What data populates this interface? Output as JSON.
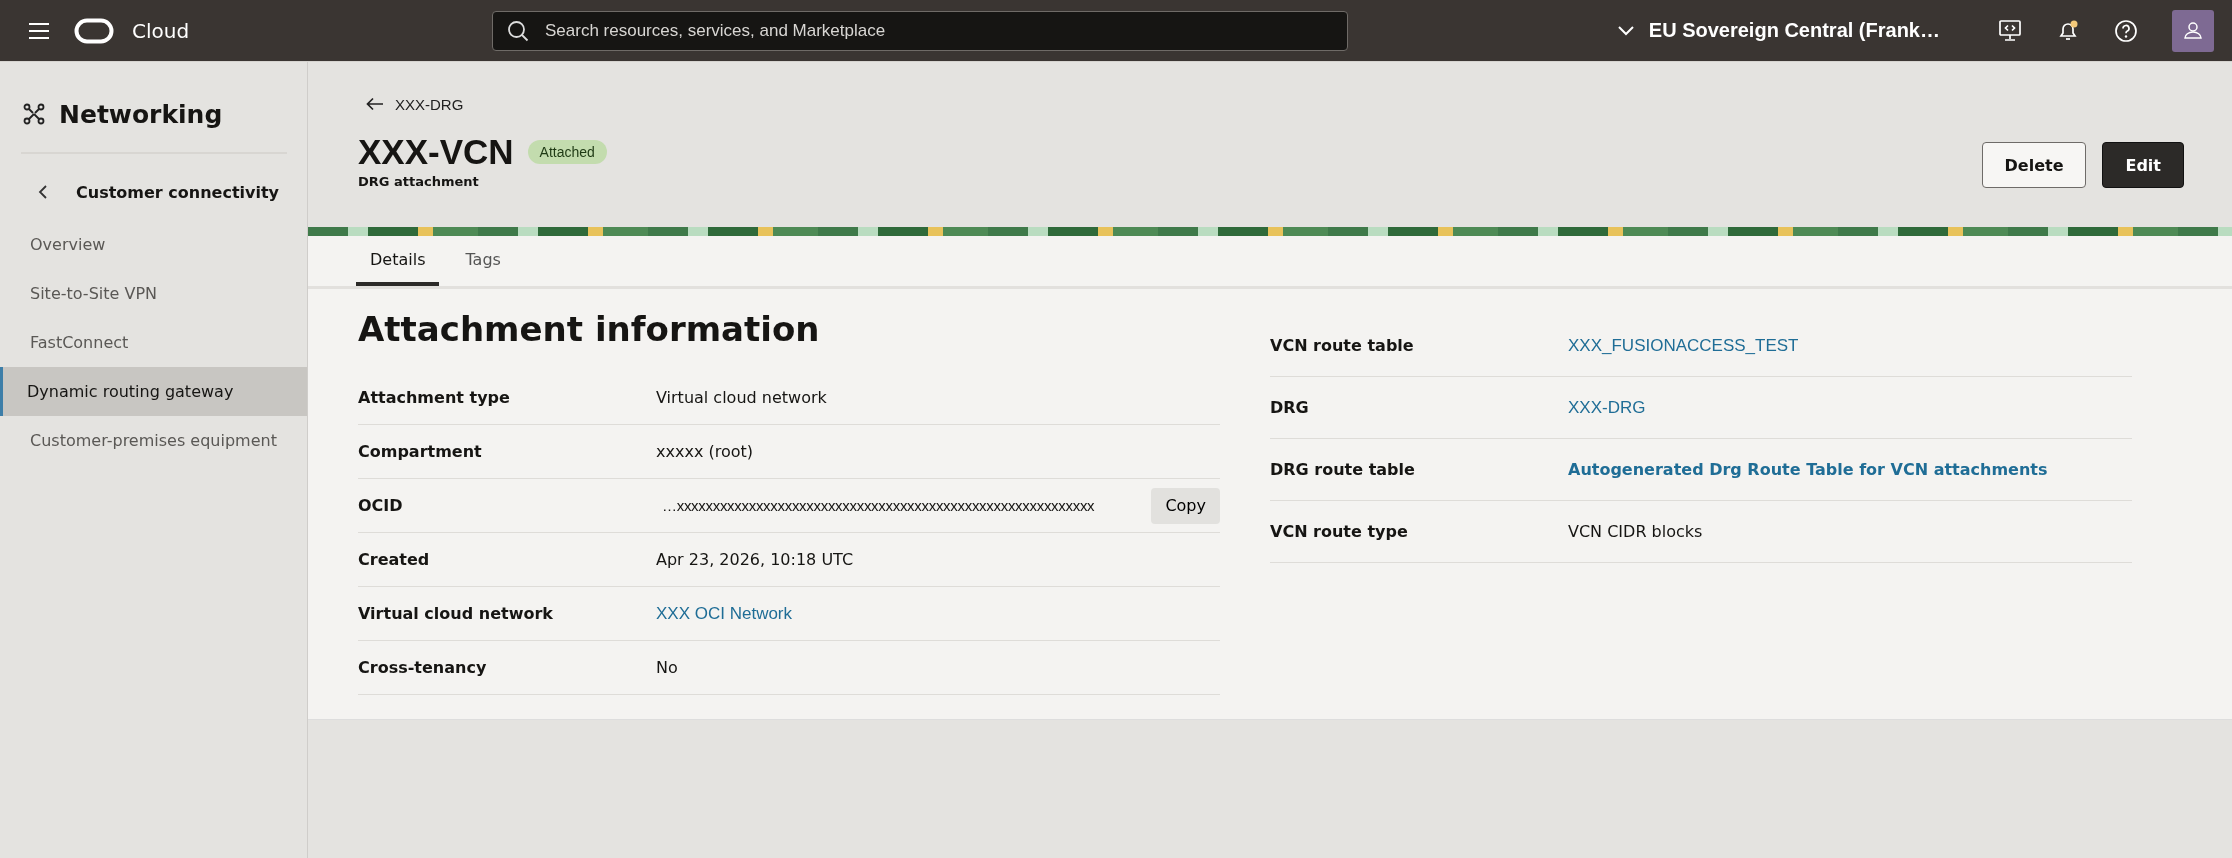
{
  "top_bar": {
    "brand": "Cloud",
    "search": {
      "placeholder": "Search resources, services, and Marketplace"
    },
    "region": "EU Sovereign Central (Frank…"
  },
  "sidebar": {
    "title": "Networking",
    "section": "Customer connectivity",
    "items": [
      {
        "label": "Overview",
        "selected": false
      },
      {
        "label": "Site-to-Site VPN",
        "selected": false
      },
      {
        "label": "FastConnect",
        "selected": false
      },
      {
        "label": "Dynamic routing gateway",
        "selected": true
      },
      {
        "label": "Customer-premises equipment",
        "selected": false
      }
    ]
  },
  "header": {
    "breadcrumb": "XXX-DRG",
    "title": "XXX-VCN",
    "status": "Attached",
    "subtitle": "DRG attachment",
    "buttons": [
      {
        "label": "Delete",
        "kind": "secondary"
      },
      {
        "label": "Edit",
        "kind": "primary"
      }
    ]
  },
  "tabs": [
    {
      "label": "Details",
      "selected": true
    },
    {
      "label": "Tags",
      "selected": false
    }
  ],
  "details": {
    "heading": "Attachment information",
    "left_rows": [
      {
        "label": "Attachment type",
        "value": "Virtual cloud network",
        "kind": "text"
      },
      {
        "label": "Compartment",
        "value": "xxxxx (root)",
        "kind": "text"
      },
      {
        "label": "OCID",
        "value": "…xxxxxxxxxxxxxxxxxxxxxxxxxxxxxxxxxxxxxxxxxxxxxxxxxxxxxxxxxx",
        "kind": "copy",
        "action": "Copy"
      },
      {
        "label": "Created",
        "value": "Apr 23, 2026, 10:18 UTC",
        "kind": "text"
      },
      {
        "label": "Virtual cloud network",
        "value": "XXX OCI Network",
        "kind": "link"
      },
      {
        "label": "Cross-tenancy",
        "value": "No",
        "kind": "text"
      }
    ],
    "right_rows": [
      {
        "label": "VCN route table",
        "value": "XXX_FUSIONACCESS_TEST",
        "kind": "link"
      },
      {
        "label": "DRG",
        "value": "XXX-DRG",
        "kind": "link"
      },
      {
        "label": "DRG route table",
        "value": "Autogenerated Drg Route Table for VCN attachments",
        "kind": "strong-link"
      },
      {
        "label": "VCN route type",
        "value": "VCN CIDR blocks",
        "kind": "text"
      }
    ]
  }
}
